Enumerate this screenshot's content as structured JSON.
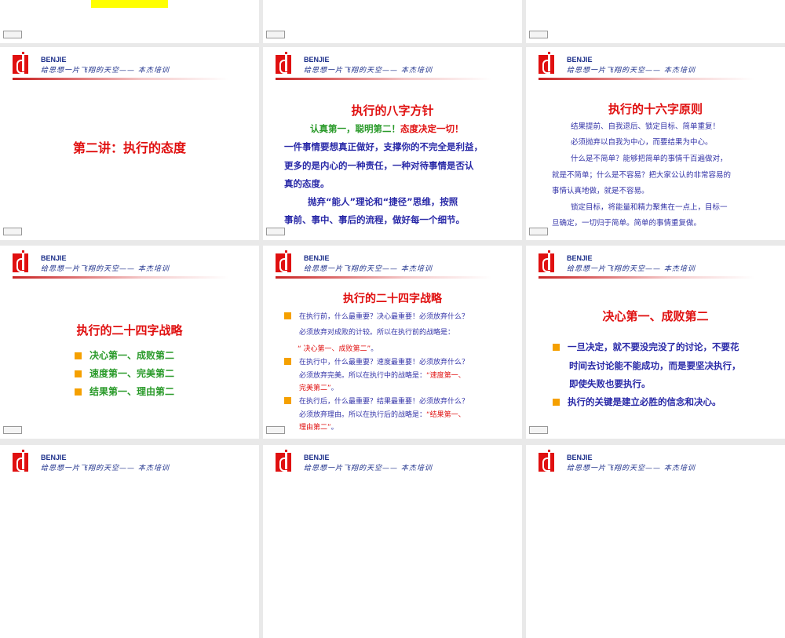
{
  "header": {
    "brand": "BENJIE",
    "slogan": "给思想一片飞翔的天空—— 本杰培训"
  },
  "slide_icon": "slide-transition-icon",
  "slides": {
    "s4": {
      "title": "第二讲：执行的态度"
    },
    "s5": {
      "title": "执行的八字方针",
      "sub_green": "认真第一，聪明第二！",
      "sub_red": "态度决定一切！",
      "p1": "一件事情要想真正做好，支撑你的不完全是利益，",
      "p2": "更多的是内心的一种责任，一种对待事情是否认",
      "p3": "真的态度。",
      "p4": "抛弃“能人”理论和“捷径”思维，按照",
      "p5": "事前、事中、事后的流程，做好每一个细节。"
    },
    "s6": {
      "title": "执行的十六字原则",
      "sub": "结果提前、自我退后、锁定目标、简单重复！",
      "l1": "必须抛弃以自我为中心，而要结果为中心。",
      "l2": "什么是不简单？能够把简单的事情千百遍做对，",
      "l3": "就是不简单；什么是不容易？把大家公认的非常容易的",
      "l4": "事情认真地做，就是不容易。",
      "l5": "锁定目标，将能量和精力聚焦在一点上，目标一",
      "l6": "旦确定，一切归于简单。简单的事情重复做。"
    },
    "s7": {
      "title": "执行的二十四字战略",
      "items": [
        "决心第一、成败第二",
        "速度第一、完美第二",
        "结果第一、理由第二"
      ]
    },
    "s8": {
      "title": "执行的二十四字战略",
      "b1a": "在执行前，什么最重要？决心最重要！必须放弃什么？",
      "b1b": "必须放弃对成败的计较。所以在执行前的战略是：",
      "b1c": "“ 决心第一、成败第二”",
      "b1d": "。",
      "b2a": "在执行中，什么最重要？速度最重要！必须放弃什么？",
      "b2b": "必须放弃完美。所以在执行中的战略是：",
      "b2c": "“速度第一、",
      "b2d": "完美第二”",
      "b2e": "。",
      "b3a": "在执行后，什么最重要？结果最重要！必须放弃什么？",
      "b3b": "必须放弃理由。所以在执行后的战略是：",
      "b3c": "“结果第一、",
      "b3d": "理由第二”",
      "b3e": "。"
    },
    "s9": {
      "title": "决心第一、成败第二",
      "b1a": "一旦决定，就不要没完没了的讨论，不要花",
      "b1b": "时间去讨论能不能成功，而是要坚决执行，",
      "b1c": "即使失败也要执行。",
      "b2": "执行的关键是建立必胜的信念和决心。"
    }
  }
}
